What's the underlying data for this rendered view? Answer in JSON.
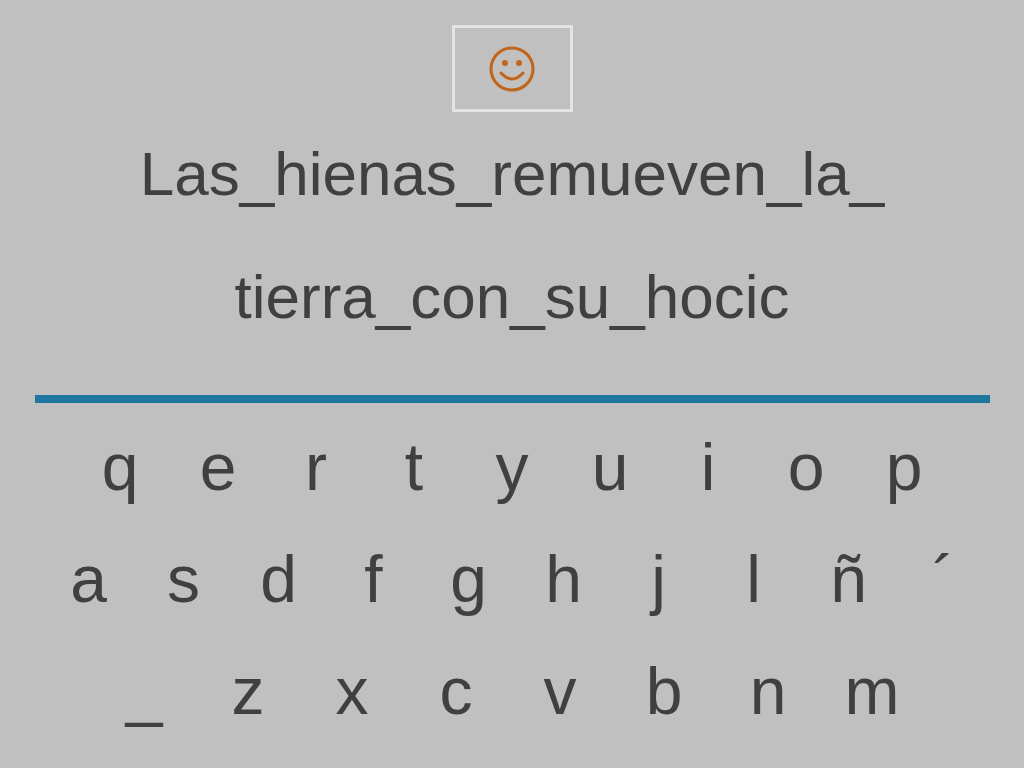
{
  "phrase_lines": [
    "Las_hienas_remueven_la_",
    "tierra_con_su_hocic"
  ],
  "keyboard": [
    [
      "q",
      "e",
      "r",
      "t",
      "y",
      "u",
      "i",
      "o",
      "p"
    ],
    [
      "a",
      "s",
      "d",
      "f",
      "g",
      "h",
      "j",
      "l",
      "ñ",
      "´"
    ],
    [
      "_",
      "z",
      "x",
      "c",
      "v",
      "b",
      "n",
      "m"
    ]
  ]
}
